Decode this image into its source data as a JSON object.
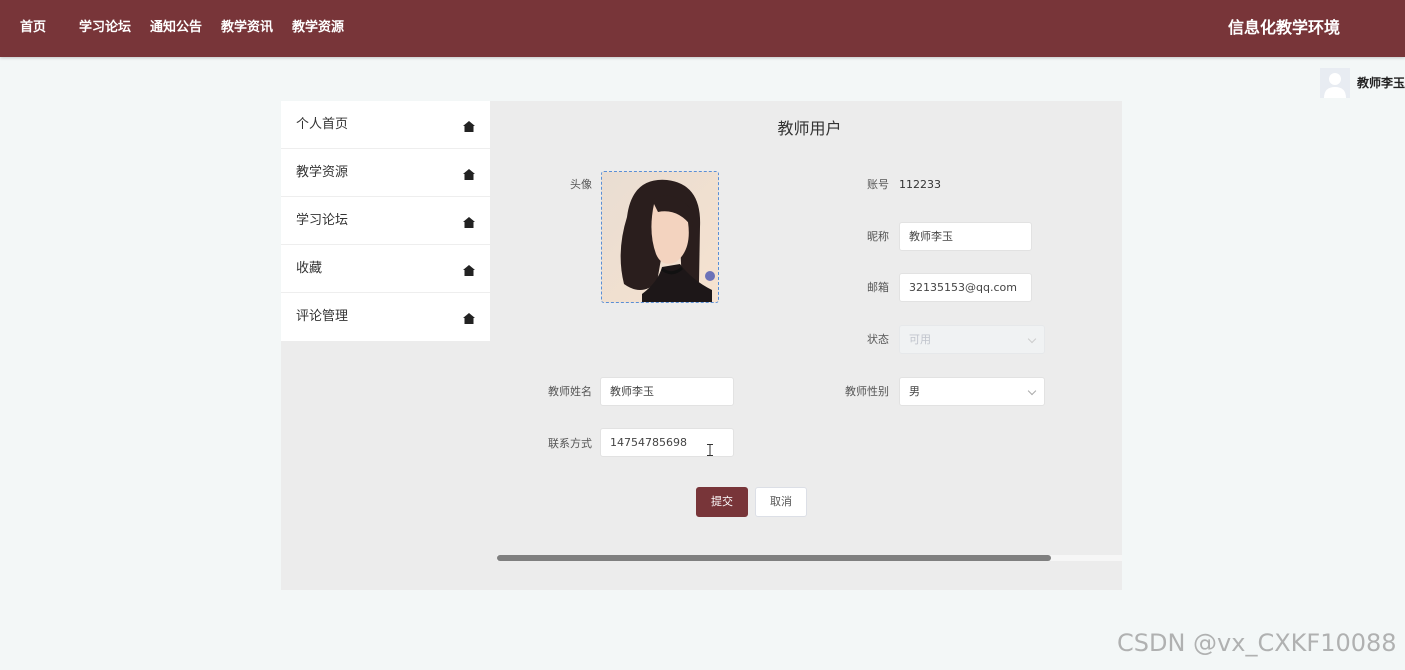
{
  "nav": {
    "items": [
      {
        "label": "首页"
      },
      {
        "label": "学习论坛"
      },
      {
        "label": "通知公告"
      },
      {
        "label": "教学资讯"
      },
      {
        "label": "教学资源"
      }
    ],
    "site_title": "信息化教学环境"
  },
  "user": {
    "name": "教师李玉"
  },
  "side_menu": {
    "items": [
      {
        "label": "个人首页",
        "icon": "home-icon"
      },
      {
        "label": "教学资源",
        "icon": "home-icon"
      },
      {
        "label": "学习论坛",
        "icon": "home-icon"
      },
      {
        "label": "收藏",
        "icon": "home-icon"
      },
      {
        "label": "评论管理",
        "icon": "home-icon"
      }
    ]
  },
  "form": {
    "title": "教师用户",
    "avatar_label": "头像",
    "account_label": "账号",
    "account_value": "112233",
    "nickname_label": "昵称",
    "nickname_value": "教师李玉",
    "email_label": "邮箱",
    "email_value": "32135153@qq.com",
    "status_label": "状态",
    "status_value": "可用",
    "teacher_name_label": "教师姓名",
    "teacher_name_value": "教师李玉",
    "gender_label": "教师性别",
    "gender_value": "男",
    "contact_label": "联系方式",
    "contact_value": "14754785698",
    "submit_label": "提交",
    "cancel_label": "取消"
  },
  "colors": {
    "brand": "#783539",
    "page_bg": "#f3f7f7",
    "panel_bg": "#ececec"
  },
  "watermark": "CSDN @vx_CXKF10088"
}
